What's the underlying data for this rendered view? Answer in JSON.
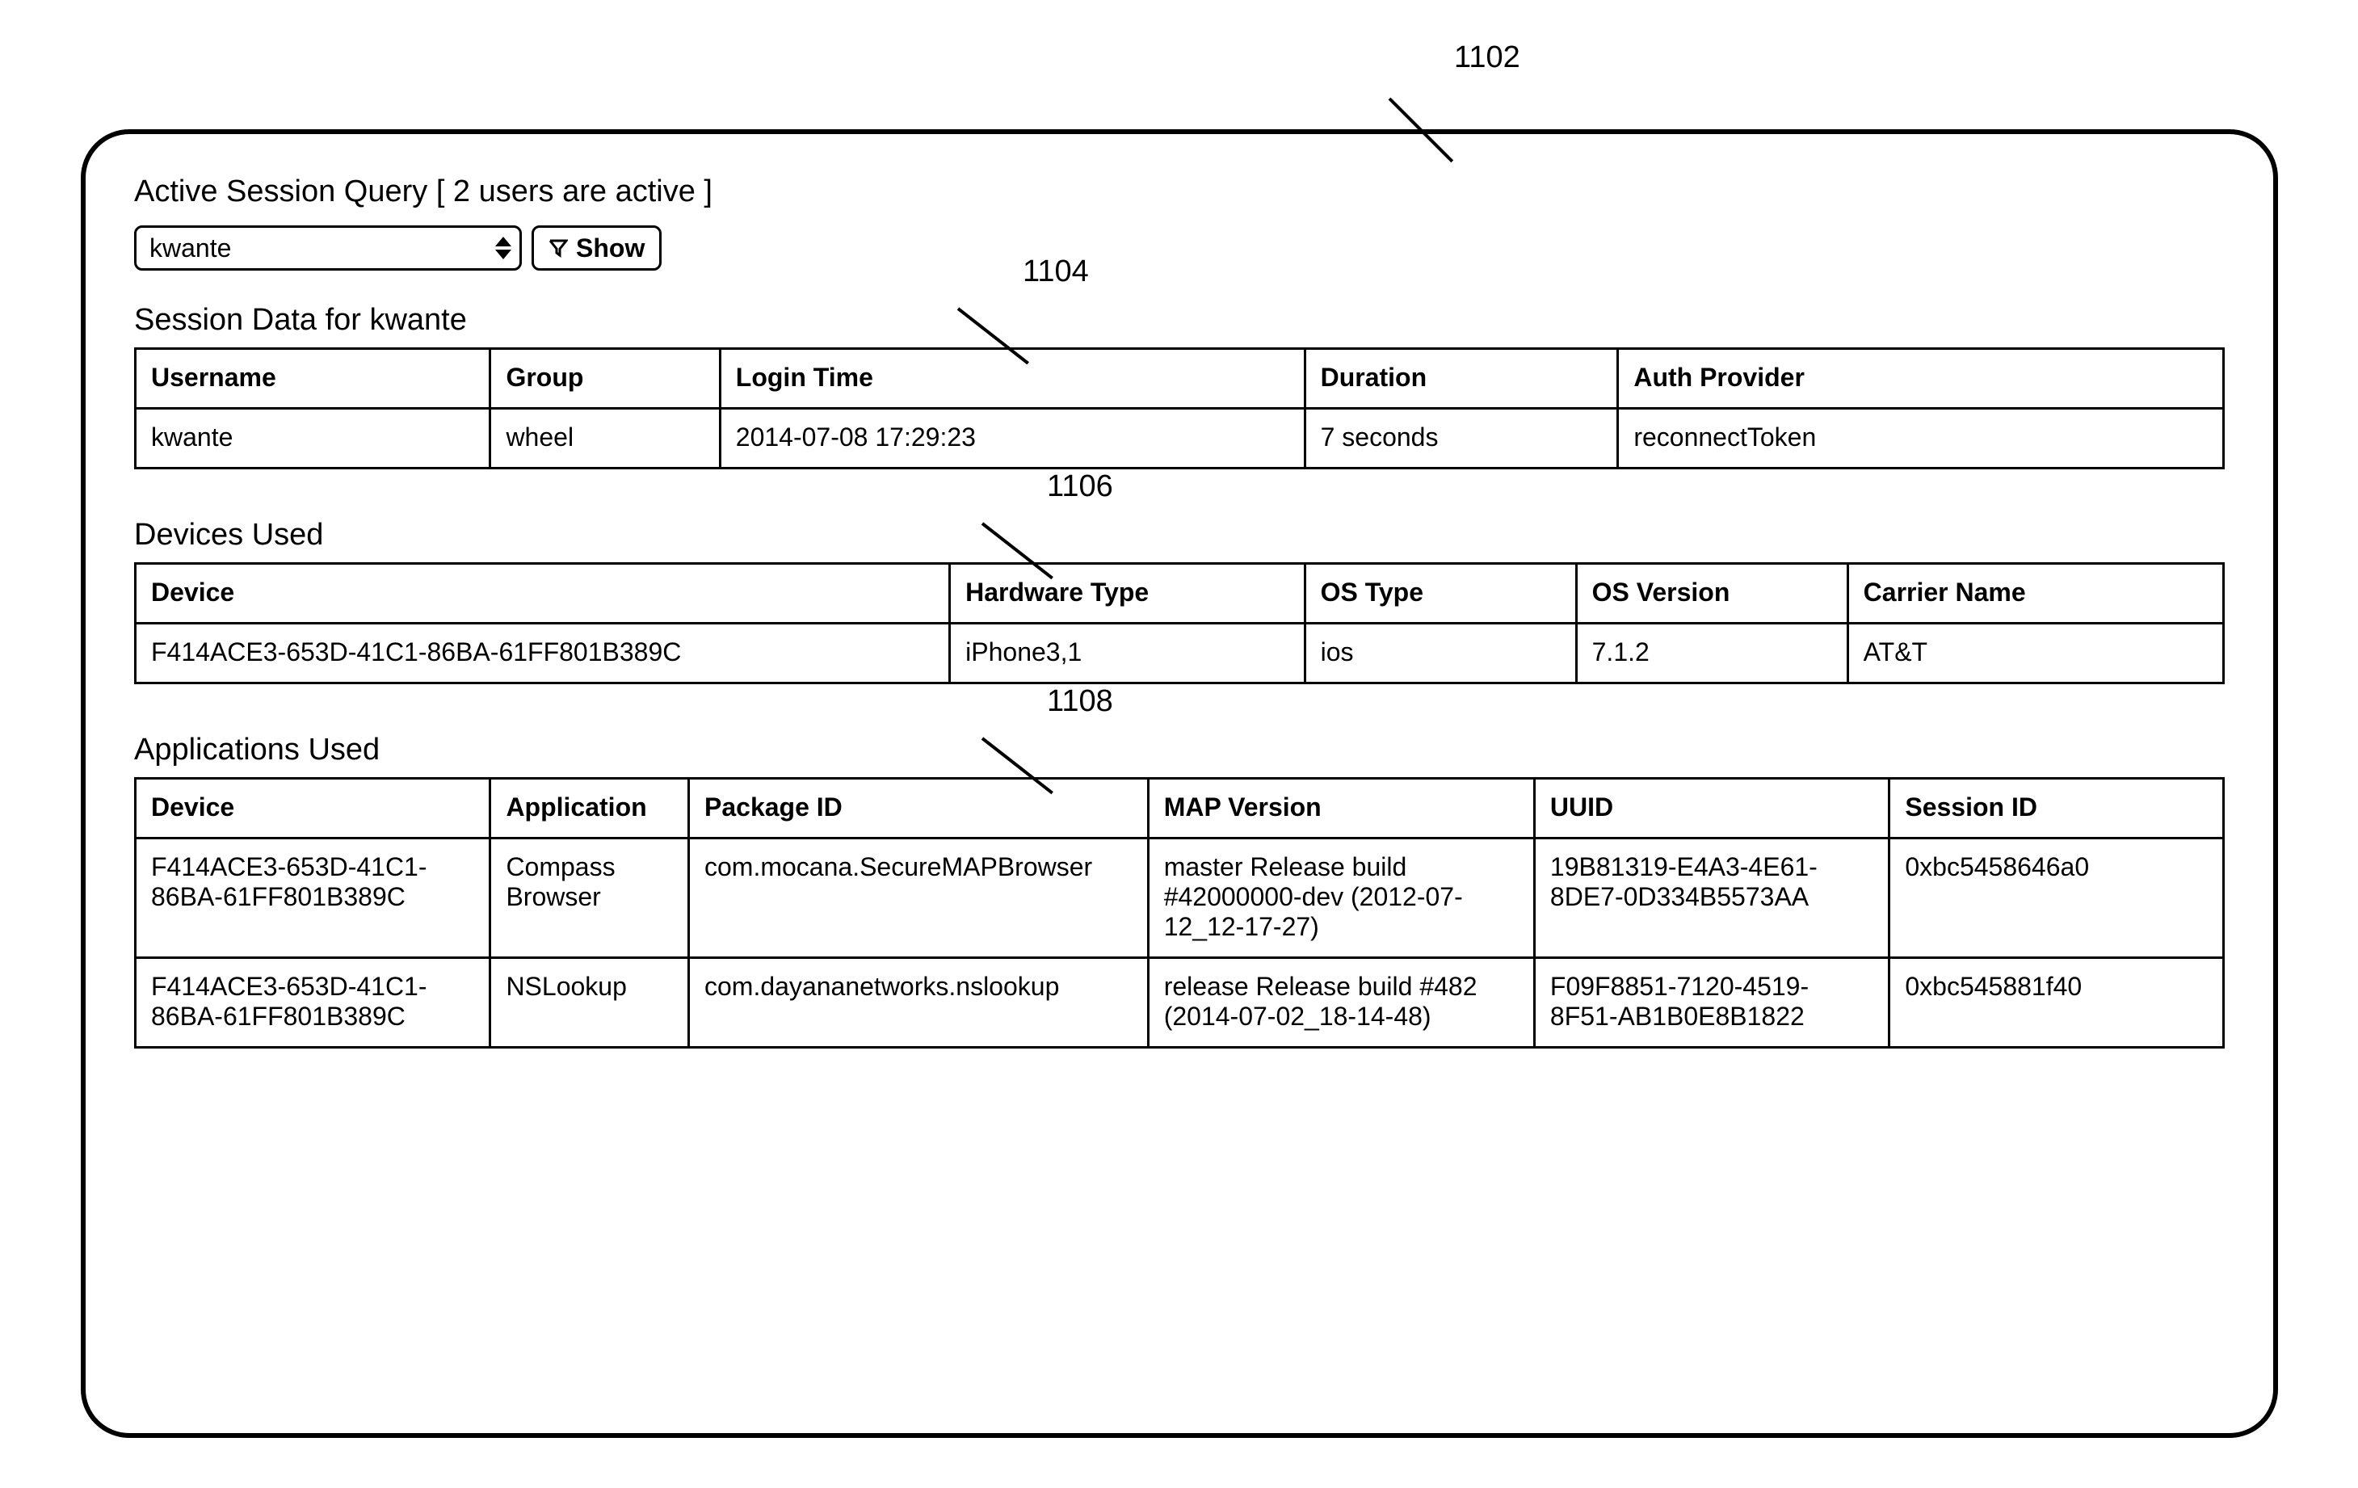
{
  "refs": {
    "panel": "1102",
    "session": "1104",
    "devices": "1106",
    "apps": "1108"
  },
  "query": {
    "title": "Active Session Query [ 2 users are active ]",
    "selected_user": "kwante",
    "show_label": "Show"
  },
  "session": {
    "title": "Session Data for kwante",
    "headers": [
      "Username",
      "Group",
      "Login Time",
      "Duration",
      "Auth Provider"
    ],
    "rows": [
      {
        "c0": "kwante",
        "c1": "wheel",
        "c2": "2014-07-08  17:29:23",
        "c3": "7 seconds",
        "c4": "reconnectToken"
      }
    ]
  },
  "devices": {
    "title": "Devices Used",
    "headers": [
      "Device",
      "Hardware Type",
      "OS Type",
      "OS Version",
      "Carrier Name"
    ],
    "rows": [
      {
        "c0": "F414ACE3-653D-41C1-86BA-61FF801B389C",
        "c1": "iPhone3,1",
        "c2": "ios",
        "c3": "7.1.2",
        "c4": "AT&T"
      }
    ]
  },
  "apps": {
    "title": "Applications Used",
    "headers": [
      "Device",
      "Application",
      "Package ID",
      "MAP Version",
      "UUID",
      "Session ID"
    ],
    "rows": [
      {
        "c0": "F414ACE3-653D-41C1-86BA-61FF801B389C",
        "c1": "Compass Browser",
        "c2": "com.mocana.SecureMAPBrowser",
        "c3": "master Release build #42000000-dev (2012-07-12_12-17-27)",
        "c4": "19B81319-E4A3-4E61-8DE7-0D334B5573AA",
        "c5": "0xbc5458646a0"
      },
      {
        "c0": "F414ACE3-653D-41C1-86BA-61FF801B389C",
        "c1": "NSLookup",
        "c2": "com.dayananetworks.nslookup",
        "c3": "release Release build #482 (2014-07-02_18-14-48)",
        "c4": "F09F8851-7120-4519-8F51-AB1B0E8B1822",
        "c5": "0xbc545881f40"
      }
    ]
  }
}
